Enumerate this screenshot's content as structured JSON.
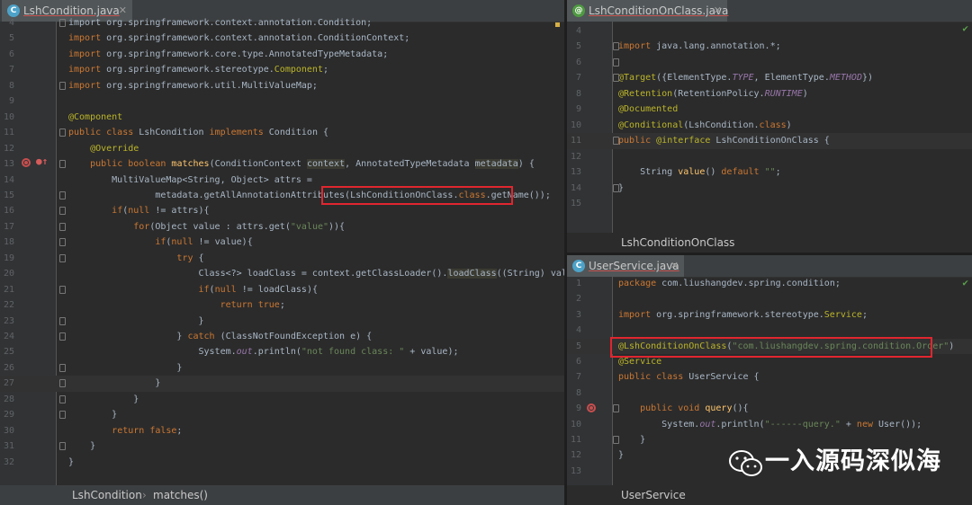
{
  "left": {
    "tab": "LshCondition.java",
    "tab_icon": "C",
    "lines": [
      {
        "n": "4",
        "html": "import org.springframework.context.annotation.Condition;"
      },
      {
        "n": "5",
        "html": "<span class='kw'>import</span> org.springframework.context.annotation.ConditionContext;"
      },
      {
        "n": "6",
        "html": "<span class='kw'>import</span> org.springframework.core.type.AnnotatedTypeMetadata;"
      },
      {
        "n": "7",
        "html": "<span class='kw'>import</span> org.springframework.stereotype.<span class='ann'>Component</span>;"
      },
      {
        "n": "8",
        "html": "<span class='kw'>import</span> org.springframework.util.MultiValueMap;"
      },
      {
        "n": "9",
        "html": ""
      },
      {
        "n": "10",
        "html": "<span class='ann'>@Component</span>"
      },
      {
        "n": "11",
        "html": "<span class='kw'>public class</span> LshCondition <span class='kw'>implements</span> Condition {"
      },
      {
        "n": "12",
        "html": "    <span class='ann'>@Override</span>"
      },
      {
        "n": "13",
        "html": "    <span class='kw'>public boolean</span> <span class='fn'>matches</span>(ConditionContext <span class='hl'>context</span>, AnnotatedTypeMetadata <span class='hl'>metadata</span>) {"
      },
      {
        "n": "14",
        "html": "        MultiValueMap&lt;String, Object&gt; attrs ="
      },
      {
        "n": "15",
        "html": "                metadata.getAllAnnotationAttributes(LshConditionOnClass.<span class='kw'>class</span>.getName());"
      },
      {
        "n": "16",
        "html": "        <span class='kw'>if</span>(<span class='kw'>null</span> != attrs){"
      },
      {
        "n": "17",
        "html": "            <span class='kw'>for</span>(Object value : attrs.get(<span class='str'>\"value\"</span>)){"
      },
      {
        "n": "18",
        "html": "                <span class='kw'>if</span>(<span class='kw'>null</span> != value){"
      },
      {
        "n": "19",
        "html": "                    <span class='kw'>try</span> {"
      },
      {
        "n": "20",
        "html": "                        Class&lt;?&gt; loadClass = context.getClassLoader().<span class='hl'>loadClass</span>((String) value);"
      },
      {
        "n": "21",
        "html": "                        <span class='kw'>if</span>(<span class='kw'>null</span> != loadClass){"
      },
      {
        "n": "22",
        "html": "                            <span class='kw'>return true</span>;"
      },
      {
        "n": "23",
        "html": "                        }"
      },
      {
        "n": "24",
        "html": "                    } <span class='kw'>catch</span> (ClassNotFoundException e) {"
      },
      {
        "n": "25",
        "html": "                        System.<span class='it'>out</span>.println(<span class='str'>\"not found class: \"</span> + value);"
      },
      {
        "n": "26",
        "html": "                    }"
      },
      {
        "n": "27",
        "html": "                }"
      },
      {
        "n": "28",
        "html": "            }"
      },
      {
        "n": "29",
        "html": "        }"
      },
      {
        "n": "30",
        "html": "        <span class='kw'>return false</span>;"
      },
      {
        "n": "31",
        "html": "    }"
      },
      {
        "n": "32",
        "html": "}"
      }
    ],
    "breadcrumb": [
      "LshCondition",
      "matches()"
    ],
    "breadcrumb_sep": "›"
  },
  "right_top": {
    "tab": "LshConditionOnClass.java",
    "tab_icon": "@",
    "lines": [
      {
        "n": "4",
        "html": ""
      },
      {
        "n": "5",
        "html": "<span class='kw'>import</span> java.lang.annotation.*;"
      },
      {
        "n": "6",
        "html": ""
      },
      {
        "n": "7",
        "html": "<span class='ann'>@Target</span>({ElementType.<span class='it'>TYPE</span>, ElementType.<span class='it'>METHOD</span>})"
      },
      {
        "n": "8",
        "html": "<span class='ann'>@Retention</span>(RetentionPolicy.<span class='it'>RUNTIME</span>)"
      },
      {
        "n": "9",
        "html": "<span class='ann'>@Documented</span>"
      },
      {
        "n": "10",
        "html": "<span class='ann'>@Conditional</span>(LshCondition.<span class='kw'>class</span>)"
      },
      {
        "n": "11",
        "html": "<span class='kw'>public</span> <span class='ann'>@interface</span> LshConditionOnClass {"
      },
      {
        "n": "12",
        "html": ""
      },
      {
        "n": "13",
        "html": "    String <span class='fn'>value</span>() <span class='kw'>default</span> <span class='str'>\"\"</span>;"
      },
      {
        "n": "14",
        "html": "}"
      },
      {
        "n": "15",
        "html": ""
      }
    ],
    "breadcrumb": "LshConditionOnClass"
  },
  "right_bottom": {
    "tab": "UserService.java",
    "tab_icon": "C",
    "lines": [
      {
        "n": "1",
        "html": "<span class='kw'>package</span> com.liushangdev.spring.condition;"
      },
      {
        "n": "2",
        "html": ""
      },
      {
        "n": "3",
        "html": "<span class='kw'>import</span> org.springframework.stereotype.<span class='ann'>Service</span>;"
      },
      {
        "n": "4",
        "html": ""
      },
      {
        "n": "5",
        "html": "<span class='ann'>@LshConditionOnClass</span>(<span class='str'>\"com.liushangdev.spring.condition.Order\"</span>)"
      },
      {
        "n": "6",
        "html": "<span class='ann'>@Service</span>"
      },
      {
        "n": "7",
        "html": "<span class='kw'>public class</span> UserService {"
      },
      {
        "n": "8",
        "html": ""
      },
      {
        "n": "9",
        "html": "    <span class='kw'>public void</span> <span class='fn'>query</span>(){"
      },
      {
        "n": "10",
        "html": "        System.<span class='it'>out</span>.println(<span class='str'>\"------query.\"</span> + <span class='kw'>new</span> User());"
      },
      {
        "n": "11",
        "html": "    }"
      },
      {
        "n": "12",
        "html": "}"
      },
      {
        "n": "13",
        "html": ""
      }
    ],
    "breadcrumb": "UserService"
  },
  "watermark": "一入源码深似海",
  "colors": {
    "highlight_box": "#e0262f",
    "editor_bg": "#2b2b2b",
    "keyword": "#cc7832",
    "annotation": "#bbb529",
    "string": "#6a8759"
  }
}
